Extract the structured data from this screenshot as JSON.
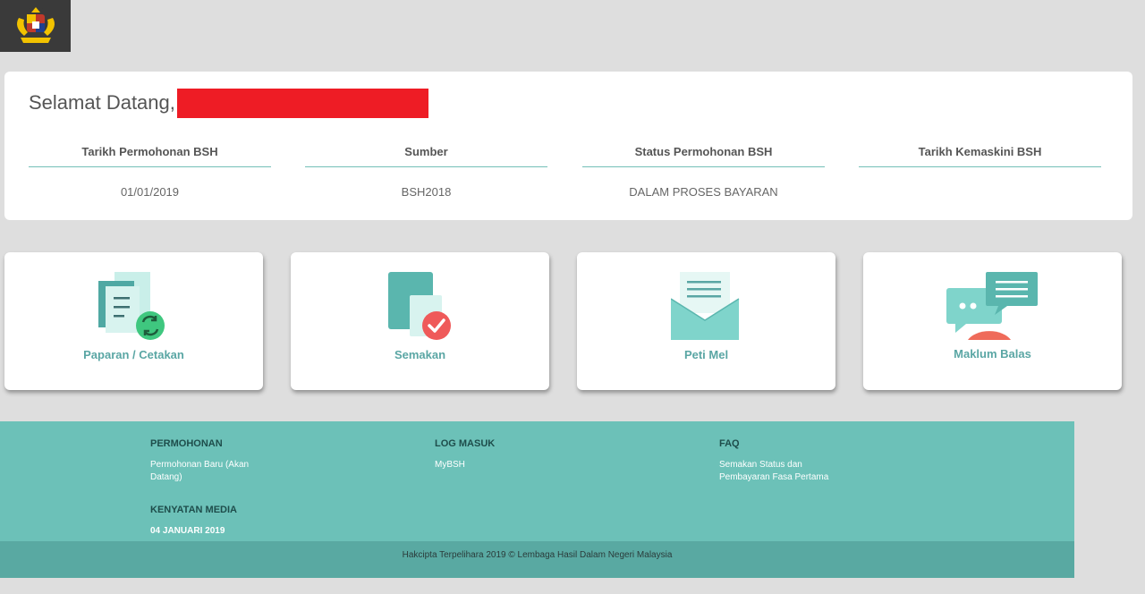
{
  "header": {
    "logo_icon": "malaysia-coat-of-arms-icon"
  },
  "welcome": {
    "greeting": "Selamat Datang,",
    "columns": [
      {
        "heading": "Tarikh Permohonan BSH",
        "value": "01/01/2019"
      },
      {
        "heading": "Sumber",
        "value": "BSH2018"
      },
      {
        "heading": "Status Permohonan BSH",
        "value": "DALAM PROSES BAYARAN"
      },
      {
        "heading": "Tarikh Kemaskini BSH",
        "value": ""
      }
    ]
  },
  "tiles": [
    {
      "label": "Paparan / Cetakan",
      "icon": "documents-refresh-icon"
    },
    {
      "label": "Semakan",
      "icon": "check-document-icon"
    },
    {
      "label": "Peti Mel",
      "icon": "mail-envelope-icon"
    },
    {
      "label": "Maklum Balas",
      "icon": "chat-bubbles-icon"
    }
  ],
  "footer": {
    "sections": [
      {
        "heading": "PERMOHONAN",
        "link": "Permohonan Baru (Akan Datang)"
      },
      {
        "heading": "LOG MASUK",
        "link": "MyBSH"
      },
      {
        "heading": "FAQ",
        "link": "Semakan Status dan Pembayaran Fasa Pertama"
      },
      {
        "heading": "KENYATAN MEDIA",
        "link": "04 JANUARI 2019"
      }
    ],
    "copyright": "Hakcipta Terpelihara 2019 © Lembaga Hasil Dalam Negeri Malaysia"
  },
  "colors": {
    "accent": "#6cc1b8",
    "accent_dark": "#59a9a2",
    "tile_label": "#5aa6a4",
    "redaction": "#ee1c25"
  }
}
